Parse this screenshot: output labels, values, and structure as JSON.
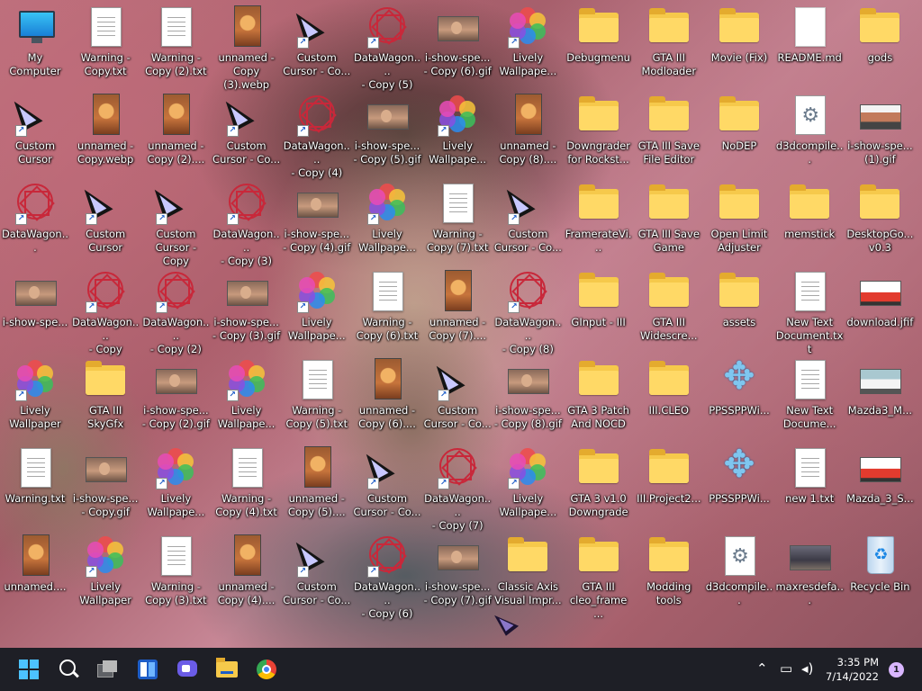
{
  "desktop": {
    "icons": [
      {
        "label": "My Computer",
        "type": "pc",
        "col": 0,
        "row": 0
      },
      {
        "label": "Warning -\nCopy.txt",
        "type": "doc",
        "col": 1,
        "row": 0
      },
      {
        "label": "Warning -\nCopy (2).txt",
        "type": "doc",
        "col": 2,
        "row": 0
      },
      {
        "label": "unnamed -\nCopy\n(3).webp",
        "type": "web",
        "col": 3,
        "row": 0
      },
      {
        "label": "Custom\nCursor - Co...",
        "type": "cursor",
        "col": 4,
        "row": 0,
        "shortcut": true
      },
      {
        "label": "DataWagon....\n- Copy (5)",
        "type": "star",
        "col": 5,
        "row": 0,
        "shortcut": true
      },
      {
        "label": "i-show-spe...\n- Copy (6).gif",
        "type": "gif",
        "col": 6,
        "row": 0
      },
      {
        "label": "Lively\nWallpape...",
        "type": "petals",
        "col": 7,
        "row": 0,
        "shortcut": true
      },
      {
        "label": "Debugmenu",
        "type": "folder",
        "col": 8,
        "row": 0
      },
      {
        "label": "GTA III\nModloader",
        "type": "folder",
        "col": 9,
        "row": 0
      },
      {
        "label": "Movie (Fix)",
        "type": "folder",
        "col": 10,
        "row": 0
      },
      {
        "label": "README.md",
        "type": "plain",
        "col": 11,
        "row": 0
      },
      {
        "label": "gods",
        "type": "folder",
        "col": 12,
        "row": 0
      },
      {
        "label": "Custom\nCursor",
        "type": "cursor",
        "col": 0,
        "row": 1,
        "shortcut": true
      },
      {
        "label": "unnamed -\nCopy.webp",
        "type": "web",
        "col": 1,
        "row": 1
      },
      {
        "label": "unnamed -\nCopy (2)....",
        "type": "web",
        "col": 2,
        "row": 1
      },
      {
        "label": "Custom\nCursor - Co...",
        "type": "cursor",
        "col": 3,
        "row": 1,
        "shortcut": true
      },
      {
        "label": "DataWagon....\n- Copy (4)",
        "type": "star",
        "col": 4,
        "row": 1,
        "shortcut": true
      },
      {
        "label": "i-show-spe...\n- Copy (5).gif",
        "type": "gif",
        "col": 5,
        "row": 1
      },
      {
        "label": "Lively\nWallpape...",
        "type": "petals",
        "col": 6,
        "row": 1,
        "shortcut": true
      },
      {
        "label": "unnamed -\nCopy (8)....",
        "type": "web",
        "col": 7,
        "row": 1
      },
      {
        "label": "Downgrader\nfor Rockst...",
        "type": "folder",
        "col": 8,
        "row": 1
      },
      {
        "label": "GTA III Save\nFile Editor",
        "type": "folder",
        "col": 9,
        "row": 1
      },
      {
        "label": "NoDEP",
        "type": "folder",
        "col": 10,
        "row": 1
      },
      {
        "label": "d3dcompile...",
        "type": "gear",
        "col": 11,
        "row": 1
      },
      {
        "label": "i-show-spe...\n(1).gif",
        "type": "photo-boy",
        "col": 12,
        "row": 1
      },
      {
        "label": "DataWagon...",
        "type": "star",
        "col": 0,
        "row": 2,
        "shortcut": true
      },
      {
        "label": "Custom\nCursor",
        "type": "cursor",
        "col": 1,
        "row": 2,
        "shortcut": true
      },
      {
        "label": "Custom\nCursor - Copy",
        "type": "cursor",
        "col": 2,
        "row": 2,
        "shortcut": true
      },
      {
        "label": "DataWagon....\n- Copy (3)",
        "type": "star",
        "col": 3,
        "row": 2,
        "shortcut": true
      },
      {
        "label": "i-show-spe...\n- Copy (4).gif",
        "type": "gif",
        "col": 4,
        "row": 2
      },
      {
        "label": "Lively\nWallpape...",
        "type": "petals",
        "col": 5,
        "row": 2,
        "shortcut": true
      },
      {
        "label": "Warning -\nCopy (7).txt",
        "type": "doc",
        "col": 6,
        "row": 2
      },
      {
        "label": "Custom\nCursor - Co...",
        "type": "cursor",
        "col": 7,
        "row": 2,
        "shortcut": true
      },
      {
        "label": "FramerateVi...",
        "type": "folder",
        "col": 8,
        "row": 2
      },
      {
        "label": "GTA III Save\nGame",
        "type": "folder",
        "col": 9,
        "row": 2
      },
      {
        "label": "Open Limit\nAdjuster",
        "type": "folder",
        "col": 10,
        "row": 2
      },
      {
        "label": "memstick",
        "type": "folder",
        "col": 11,
        "row": 2
      },
      {
        "label": "DesktopGo...\nv0.3",
        "type": "folder",
        "col": 12,
        "row": 2
      },
      {
        "label": "i-show-spe...",
        "type": "gif",
        "col": 0,
        "row": 3
      },
      {
        "label": "DataWagon....\n- Copy",
        "type": "star",
        "col": 1,
        "row": 3,
        "shortcut": true
      },
      {
        "label": "DataWagon....\n- Copy (2)",
        "type": "star",
        "col": 2,
        "row": 3,
        "shortcut": true
      },
      {
        "label": "i-show-spe...\n- Copy (3).gif",
        "type": "gif",
        "col": 3,
        "row": 3
      },
      {
        "label": "Lively\nWallpape...",
        "type": "petals",
        "col": 4,
        "row": 3,
        "shortcut": true
      },
      {
        "label": "Warning -\nCopy (6).txt",
        "type": "doc",
        "col": 5,
        "row": 3
      },
      {
        "label": "unnamed -\nCopy (7)....",
        "type": "web",
        "col": 6,
        "row": 3
      },
      {
        "label": "DataWagon....\n- Copy (8)",
        "type": "star",
        "col": 7,
        "row": 3,
        "shortcut": true
      },
      {
        "label": "GInput - III",
        "type": "folder",
        "col": 8,
        "row": 3
      },
      {
        "label": "GTA III\nWidescre...",
        "type": "folder",
        "col": 9,
        "row": 3
      },
      {
        "label": "assets",
        "type": "folder",
        "col": 10,
        "row": 3
      },
      {
        "label": "New Text\nDocument.txt",
        "type": "doc",
        "col": 11,
        "row": 3
      },
      {
        "label": "download.jfif",
        "type": "photo-red",
        "col": 12,
        "row": 3
      },
      {
        "label": "Lively\nWallpaper",
        "type": "petals",
        "col": 0,
        "row": 4,
        "shortcut": true
      },
      {
        "label": "GTA III SkyGfx",
        "type": "folder",
        "col": 1,
        "row": 4
      },
      {
        "label": "i-show-spe...\n- Copy (2).gif",
        "type": "gif",
        "col": 2,
        "row": 4
      },
      {
        "label": "Lively\nWallpape...",
        "type": "petals",
        "col": 3,
        "row": 4,
        "shortcut": true
      },
      {
        "label": "Warning -\nCopy (5).txt",
        "type": "doc",
        "col": 4,
        "row": 4
      },
      {
        "label": "unnamed -\nCopy (6)....",
        "type": "web",
        "col": 5,
        "row": 4
      },
      {
        "label": "Custom\nCursor - Co...",
        "type": "cursor",
        "col": 6,
        "row": 4,
        "shortcut": true
      },
      {
        "label": "i-show-spe...\n- Copy (8).gif",
        "type": "gif",
        "col": 7,
        "row": 4
      },
      {
        "label": "GTA 3 Patch\nAnd NOCD",
        "type": "folder",
        "col": 8,
        "row": 4
      },
      {
        "label": "III.CLEO",
        "type": "folder",
        "col": 9,
        "row": 4
      },
      {
        "label": "PPSSPPWi...",
        "type": "psp",
        "col": 10,
        "row": 4
      },
      {
        "label": "New Text\nDocume...",
        "type": "doc",
        "col": 11,
        "row": 4
      },
      {
        "label": "Mazda3_M...",
        "type": "photo-white",
        "col": 12,
        "row": 4
      },
      {
        "label": "Warning.txt",
        "type": "doc",
        "col": 0,
        "row": 5
      },
      {
        "label": "i-show-spe...\n- Copy.gif",
        "type": "gif",
        "col": 1,
        "row": 5
      },
      {
        "label": "Lively\nWallpape...",
        "type": "petals",
        "col": 2,
        "row": 5,
        "shortcut": true
      },
      {
        "label": "Warning -\nCopy (4).txt",
        "type": "doc",
        "col": 3,
        "row": 5
      },
      {
        "label": "unnamed -\nCopy (5)....",
        "type": "web",
        "col": 4,
        "row": 5
      },
      {
        "label": "Custom\nCursor - Co...",
        "type": "cursor",
        "col": 5,
        "row": 5,
        "shortcut": true
      },
      {
        "label": "DataWagon....\n- Copy (7)",
        "type": "star",
        "col": 6,
        "row": 5,
        "shortcut": true
      },
      {
        "label": "Lively\nWallpape...",
        "type": "petals",
        "col": 7,
        "row": 5,
        "shortcut": true
      },
      {
        "label": "GTA 3 v1.0\nDowngrade",
        "type": "folder",
        "col": 8,
        "row": 5
      },
      {
        "label": "III.Project2...",
        "type": "folder",
        "col": 9,
        "row": 5
      },
      {
        "label": "PPSSPPWi...",
        "type": "psp",
        "col": 10,
        "row": 5
      },
      {
        "label": "new 1.txt",
        "type": "doc",
        "col": 11,
        "row": 5
      },
      {
        "label": "Mazda_3_S...",
        "type": "photo-red",
        "col": 12,
        "row": 5
      },
      {
        "label": "unnamed....",
        "type": "web",
        "col": 0,
        "row": 6
      },
      {
        "label": "Lively\nWallpaper",
        "type": "petals",
        "col": 1,
        "row": 6,
        "shortcut": true
      },
      {
        "label": "Warning -\nCopy (3).txt",
        "type": "doc",
        "col": 2,
        "row": 6
      },
      {
        "label": "unnamed -\nCopy (4)....",
        "type": "web",
        "col": 3,
        "row": 6
      },
      {
        "label": "Custom\nCursor - Co...",
        "type": "cursor",
        "col": 4,
        "row": 6,
        "shortcut": true
      },
      {
        "label": "DataWagon....\n- Copy (6)",
        "type": "star",
        "col": 5,
        "row": 6,
        "shortcut": true
      },
      {
        "label": "i-show-spe...\n- Copy (7).gif",
        "type": "gif",
        "col": 6,
        "row": 6
      },
      {
        "label": "Classic Axis\nVisual Impr...",
        "type": "folder",
        "col": 7,
        "row": 6
      },
      {
        "label": "GTA III\ncleo_frame ...",
        "type": "folder",
        "col": 8,
        "row": 6
      },
      {
        "label": "Modding\ntools",
        "type": "folder",
        "col": 9,
        "row": 6
      },
      {
        "label": "d3dcompile...",
        "type": "gear",
        "col": 10,
        "row": 6
      },
      {
        "label": "maxresdefa...",
        "type": "photo-cat",
        "col": 11,
        "row": 6
      },
      {
        "label": "Recycle Bin",
        "type": "recycle",
        "col": 12,
        "row": 6
      }
    ]
  },
  "taskbar": {
    "apps": [
      {
        "name": "start-icon",
        "glyph": "",
        "color": "#4cc2ff"
      },
      {
        "name": "search-icon",
        "glyph": "⚲",
        "color": "#ffffff"
      },
      {
        "name": "task-view-icon",
        "glyph": "❐",
        "color": "#cfcfcf"
      },
      {
        "name": "widgets-icon",
        "glyph": "▤",
        "color": "#3d8ee8"
      },
      {
        "name": "chat-icon",
        "glyph": "●",
        "color": "#7b6cf0"
      },
      {
        "name": "file-explorer-icon",
        "glyph": "▬",
        "color": "#f6c94b"
      },
      {
        "name": "chrome-icon",
        "glyph": "◉",
        "color": "#e94235"
      }
    ],
    "tray": {
      "time": "3:35 PM",
      "date": "7/14/2022",
      "notification_count": "1"
    }
  }
}
